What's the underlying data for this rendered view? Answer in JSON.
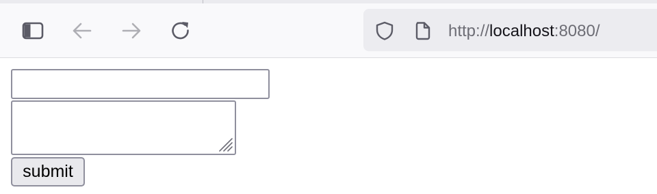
{
  "toolbar": {
    "sidebar_icon": "sidebar-icon",
    "back_icon": "back-arrow-icon",
    "forward_icon": "forward-arrow-icon",
    "reload_icon": "reload-icon"
  },
  "urlbar": {
    "security_icon": "shield-icon",
    "page_icon": "page-icon",
    "scheme": "http://",
    "host": "localhost",
    "port_path": ":8080/"
  },
  "form": {
    "text_value": "",
    "textarea_value": "",
    "submit_label": "submit"
  },
  "colors": {
    "toolbar_bg": "#f9f9fb",
    "urlbar_bg": "#ececf0",
    "icon_active": "#5b5b66",
    "icon_disabled": "#aeaeb4",
    "input_border": "#8f8f9d",
    "button_bg": "#e9e9ed"
  }
}
